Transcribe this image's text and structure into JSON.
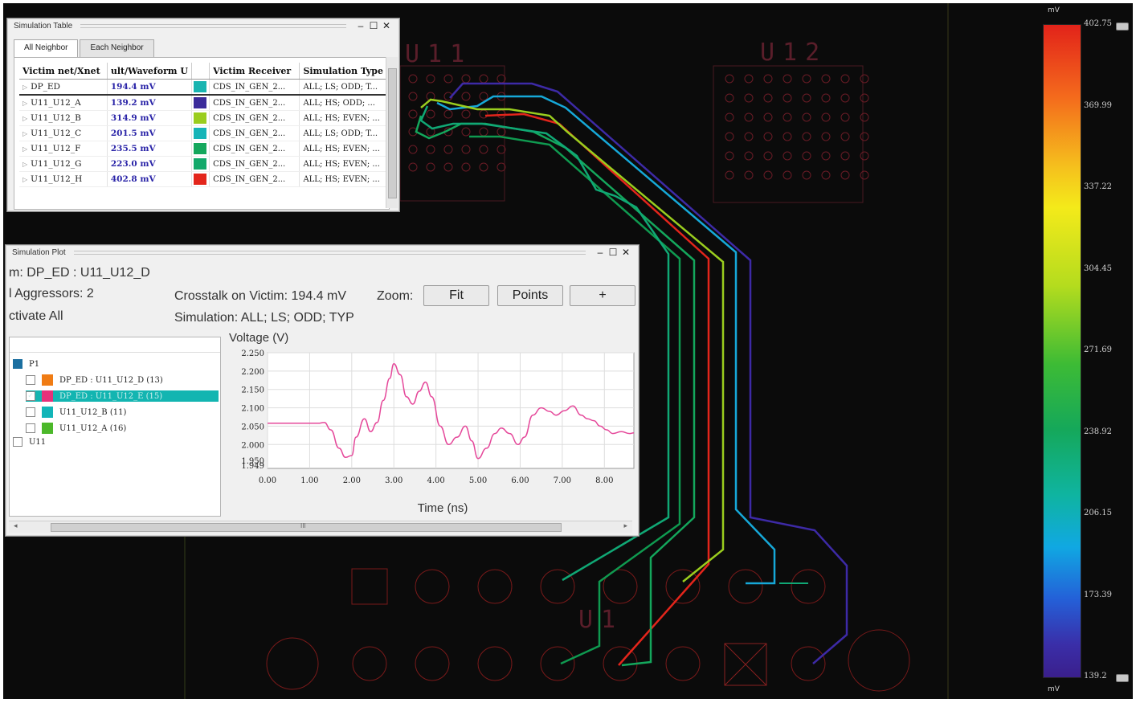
{
  "pcb": {
    "labels": {
      "u11": "U11",
      "u12": "U12",
      "u1": "U1"
    }
  },
  "color_scale": {
    "unit_top": "mV",
    "unit_bottom": "mV",
    "ticks": [
      "402.75",
      "369.99",
      "337.22",
      "304.45",
      "271.69",
      "238.92",
      "206.15",
      "173.39",
      "139.2"
    ]
  },
  "table_window": {
    "title": "Simulation Table",
    "tabs": [
      "All Neighbor",
      "Each Neighbor"
    ],
    "columns": [
      "Victim net/Xnet",
      "ult/Waveform U",
      "Victim Receiver",
      "Simulation Type"
    ],
    "rows": [
      {
        "net": "DP_ED",
        "value": "194.4 mV",
        "color": "#18b4b0",
        "receiver": "CDS_IN_GEN_2...",
        "sim_type": "ALL; LS; ODD; T..."
      },
      {
        "net": "U11_U12_A",
        "value": "139.2 mV",
        "color": "#3a2a9a",
        "receiver": "CDS_IN_GEN_2...",
        "sim_type": "ALL; HS; ODD; ..."
      },
      {
        "net": "U11_U12_B",
        "value": "314.9 mV",
        "color": "#9acd1e",
        "receiver": "CDS_IN_GEN_2...",
        "sim_type": "ALL; HS; EVEN; ..."
      },
      {
        "net": "U11_U12_C",
        "value": "201.5 mV",
        "color": "#16b4b8",
        "receiver": "CDS_IN_GEN_2...",
        "sim_type": "ALL; LS; ODD; T..."
      },
      {
        "net": "U11_U12_F",
        "value": "235.5 mV",
        "color": "#14a75c",
        "receiver": "CDS_IN_GEN_2...",
        "sim_type": "ALL; HS; EVEN; ..."
      },
      {
        "net": "U11_U12_G",
        "value": "223.0 mV",
        "color": "#12a96a",
        "receiver": "CDS_IN_GEN_2...",
        "sim_type": "ALL; HS; EVEN; ..."
      },
      {
        "net": "U11_U12_H",
        "value": "402.8 mV",
        "color": "#e3251b",
        "receiver": "CDS_IN_GEN_2...",
        "sim_type": "ALL; HS; EVEN; ..."
      }
    ]
  },
  "plot_window": {
    "title": "Simulation Plot",
    "victim_line": "m: DP_ED : U11_U12_D",
    "aggressors": "l Aggressors: 2",
    "activate": "ctivate All",
    "crosstalk": "Crosstalk on Victim: 194.4 mV",
    "zoom_label": "Zoom:",
    "zoom_buttons": [
      "Fit",
      "Points",
      "+"
    ],
    "simulation": "Simulation: ALL; LS; ODD; TYP",
    "tree": {
      "group": "P1",
      "items": [
        {
          "label": "DP_ED : U11_U12_D (13)",
          "color": "#f07c14",
          "checked": false,
          "selected": false
        },
        {
          "label": "DP_ED : U11_U12_E (15)",
          "color": "#e6317a",
          "checked": true,
          "selected": true
        },
        {
          "label": "U11_U12_B (11)",
          "color": "#12b5b8",
          "checked": false,
          "selected": false
        },
        {
          "label": "U11_U12_A (16)",
          "color": "#4cb82a",
          "checked": false,
          "selected": false
        }
      ],
      "group2": "U11"
    },
    "hscroll_mark": "III"
  },
  "chart_data": {
    "type": "line",
    "ylabel": "Voltage (V)",
    "xlabel": "Time (ns)",
    "x_ticks": [
      "0.00",
      "1.00",
      "2.00",
      "3.00",
      "4.00",
      "5.00",
      "6.00",
      "7.00",
      "8.00"
    ],
    "y_ticks": [
      "2.250",
      "2.200",
      "2.150",
      "2.100",
      "2.050",
      "2.000",
      "1.950",
      "1.949"
    ],
    "xlim": [
      0,
      8.7
    ],
    "ylim": [
      1.935,
      2.25
    ],
    "grid": true,
    "series": [
      {
        "color": "#e5489a",
        "x": [
          0,
          0.3,
          1.2,
          1.35,
          1.5,
          1.7,
          1.85,
          2.0,
          2.1,
          2.3,
          2.45,
          2.6,
          2.75,
          2.9,
          3.0,
          3.15,
          3.3,
          3.45,
          3.6,
          3.75,
          3.9,
          4.1,
          4.3,
          4.5,
          4.7,
          4.85,
          5.0,
          5.2,
          5.4,
          5.55,
          5.75,
          5.95,
          6.1,
          6.3,
          6.5,
          6.7,
          6.85,
          7.05,
          7.25,
          7.45,
          7.6,
          7.75,
          7.9,
          8.05,
          8.2,
          8.4,
          8.6,
          8.7
        ],
        "y": [
          2.058,
          2.058,
          2.058,
          2.06,
          2.04,
          1.99,
          1.965,
          1.97,
          2.02,
          2.07,
          2.035,
          2.06,
          2.12,
          2.18,
          2.22,
          2.19,
          2.13,
          2.11,
          2.145,
          2.17,
          2.13,
          2.05,
          2.0,
          2.02,
          2.05,
          2.01,
          1.962,
          1.99,
          2.03,
          2.045,
          2.03,
          2.0,
          2.02,
          2.08,
          2.1,
          2.09,
          2.08,
          2.092,
          2.105,
          2.08,
          2.07,
          2.065,
          2.05,
          2.04,
          2.03,
          2.035,
          2.03,
          2.032
        ]
      }
    ]
  }
}
